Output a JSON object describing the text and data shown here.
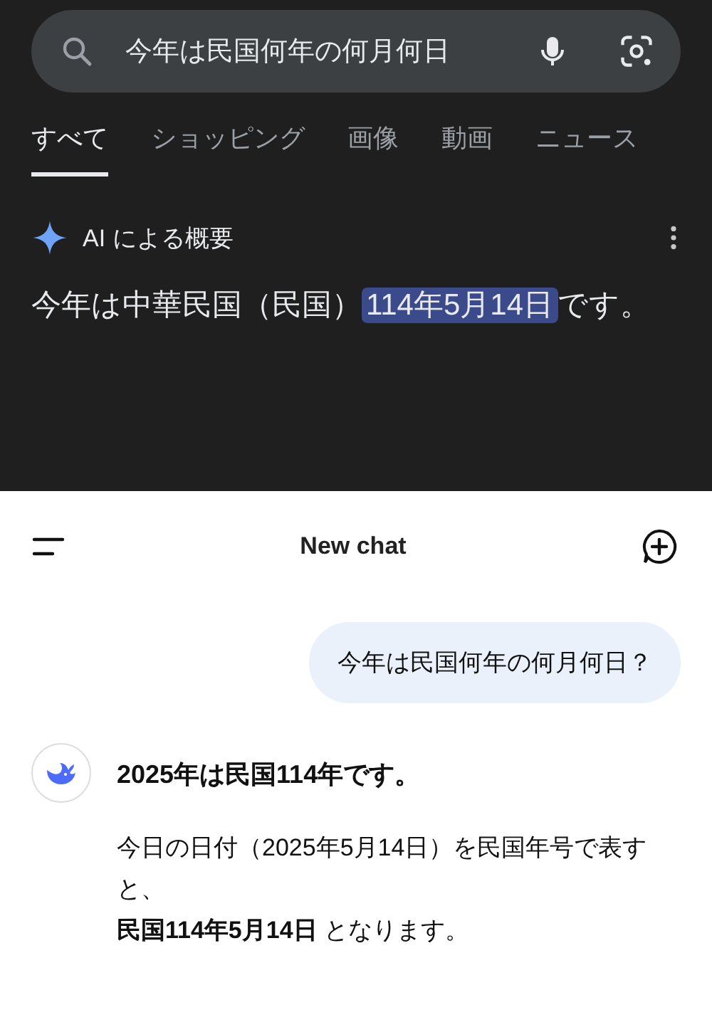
{
  "search": {
    "query": "今年は民国何年の何月何日"
  },
  "tabs": [
    {
      "label": "すべて",
      "selected": true
    },
    {
      "label": "ショッピング",
      "selected": false
    },
    {
      "label": "画像",
      "selected": false
    },
    {
      "label": "動画",
      "selected": false
    },
    {
      "label": "ニュース",
      "selected": false
    }
  ],
  "ai_overview": {
    "title": "AI による概要",
    "answer": {
      "before": "今年は中華民国（民国）",
      "highlight": "114年5月14日",
      "after": "です。"
    }
  },
  "chat": {
    "title": "New chat",
    "messages": [
      {
        "kind": "user",
        "text": "今年は民国何年の何月何日？"
      },
      {
        "kind": "bot",
        "paragraphs": [
          "**2025年は民国114年です。**",
          "今日の日付（2025年5月14日）を民国年号で表すと、",
          "**民国114年5月14日** となります。"
        ]
      }
    ]
  }
}
